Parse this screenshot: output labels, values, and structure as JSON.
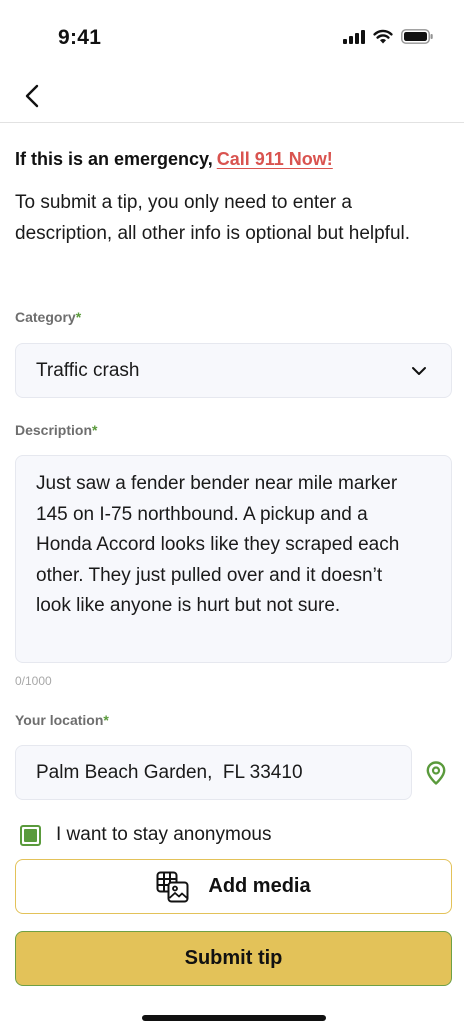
{
  "status_bar": {
    "time": "9:41",
    "icons": [
      "signal-icon",
      "wifi-icon",
      "battery-icon"
    ]
  },
  "nav": {
    "back_icon": "chevron-left-icon"
  },
  "emergency": {
    "text": "If this is an emergency,",
    "link": "Call 911 Now!",
    "link_color": "#d9534f"
  },
  "intro": "To submit a tip, you only need to enter a description, all other info is optional but helpful.",
  "form": {
    "category": {
      "label": "Category",
      "required_mark": "*",
      "value": "Traffic crash"
    },
    "description": {
      "label": "Description",
      "required_mark": "*",
      "value": "Just saw a fender bender near mile marker 145 on I-75 northbound. A pickup and a Honda Accord looks like they scraped each other.  They just pulled over and it doesn’t look like anyone is hurt but not sure.",
      "counter": "0/1000"
    },
    "location": {
      "label": "Your location",
      "required_mark": "*",
      "value": "Palm Beach Garden,  FL 33410",
      "icon": "location-pin-icon"
    },
    "anonymous": {
      "label": "I want to stay anonymous",
      "checked": true
    },
    "add_media": {
      "label": "Add media",
      "icon": "media-gallery-icon"
    },
    "submit": {
      "label": "Submit tip"
    }
  },
  "colors": {
    "accent_green": "#5a9a3c",
    "button_yellow": "#e3c259",
    "emergency_red": "#d9534f"
  }
}
